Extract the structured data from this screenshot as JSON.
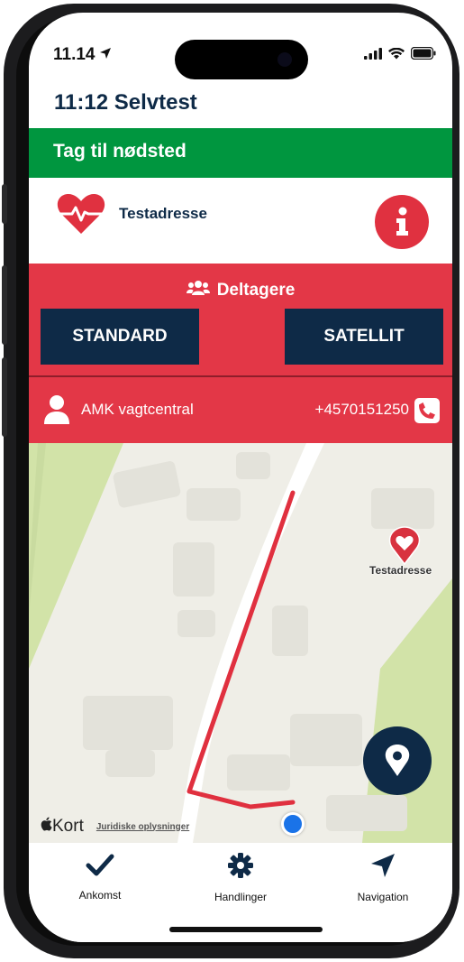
{
  "status_bar": {
    "time": "11.14"
  },
  "app": {
    "title": "11:12 Selvtest"
  },
  "banner": {
    "label": "Tag til nødsted",
    "color": "#00963f"
  },
  "incident": {
    "address": "Testadresse",
    "info_icon": "info-icon",
    "heart_icon": "heart-pulse-icon"
  },
  "participants": {
    "label": "Deltagere",
    "accent": "#e33747"
  },
  "map_types": {
    "standard": "STANDARD",
    "satellite": "SATELLIT"
  },
  "contact": {
    "name": "AMK vagtcentral",
    "phone": "+4570151250"
  },
  "map": {
    "pin_label": "Testadresse",
    "brand": "Kort",
    "legal_link": "Juridiske oplysninger",
    "route_color": "#e0303f"
  },
  "nav": {
    "arrival": "Ankomst",
    "actions": "Handlinger",
    "navigation": "Navigation"
  }
}
